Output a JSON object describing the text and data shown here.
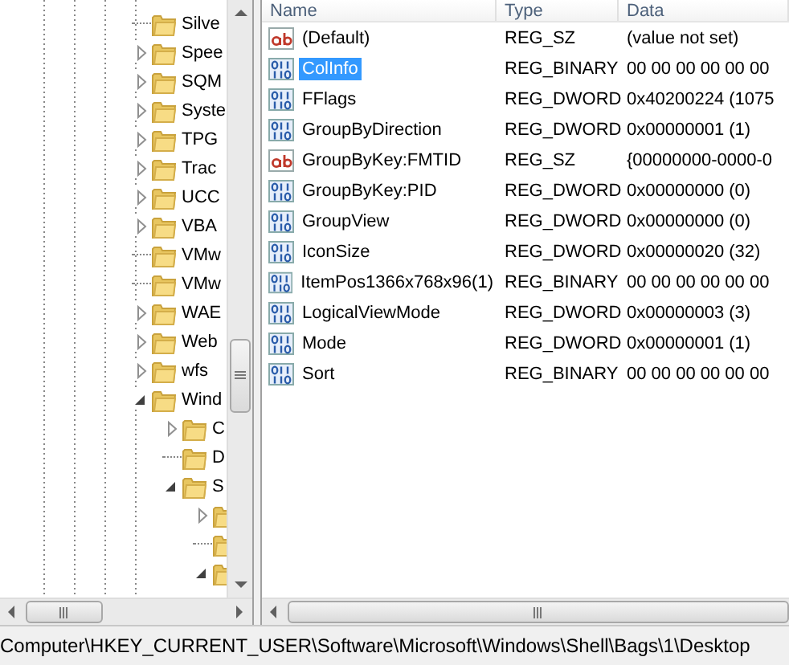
{
  "tree": {
    "items": [
      {
        "label": "Silve",
        "kind": "leaf"
      },
      {
        "label": "Spee",
        "kind": "branch",
        "expanded": false
      },
      {
        "label": "SQM",
        "kind": "branch",
        "expanded": false
      },
      {
        "label": "Syste",
        "kind": "branch",
        "expanded": false
      },
      {
        "label": "TPG",
        "kind": "branch",
        "expanded": false
      },
      {
        "label": "Trac",
        "kind": "branch",
        "expanded": false
      },
      {
        "label": "UCC",
        "kind": "branch",
        "expanded": false
      },
      {
        "label": "VBA",
        "kind": "branch",
        "expanded": false
      },
      {
        "label": "VMw",
        "kind": "leaf"
      },
      {
        "label": "VMw",
        "kind": "leaf"
      },
      {
        "label": "WAE",
        "kind": "branch",
        "expanded": false
      },
      {
        "label": "Web",
        "kind": "branch",
        "expanded": false
      },
      {
        "label": "wfs",
        "kind": "branch",
        "expanded": false
      },
      {
        "label": "Wind",
        "kind": "branch",
        "expanded": true,
        "children": [
          {
            "label": "C",
            "kind": "branch",
            "expanded": false
          },
          {
            "label": "D",
            "kind": "leaf"
          },
          {
            "label": "S",
            "kind": "branch",
            "expanded": true,
            "children": [
              {
                "kind": "branch",
                "expanded": false
              },
              {
                "kind": "leaf"
              },
              {
                "kind": "branch",
                "expanded": true
              }
            ]
          }
        ]
      }
    ]
  },
  "list": {
    "columns": [
      "Name",
      "Type",
      "Data"
    ],
    "rows": [
      {
        "kind": "string",
        "name": "(Default)",
        "type": "REG_SZ",
        "data": "(value not set)",
        "selected": false
      },
      {
        "kind": "binary",
        "name": "ColInfo",
        "type": "REG_BINARY",
        "data": "00 00 00 00 00 00",
        "selected": true
      },
      {
        "kind": "binary",
        "name": "FFlags",
        "type": "REG_DWORD",
        "data": "0x40200224 (1075",
        "selected": false
      },
      {
        "kind": "binary",
        "name": "GroupByDirection",
        "type": "REG_DWORD",
        "data": "0x00000001 (1)",
        "selected": false
      },
      {
        "kind": "string",
        "name": "GroupByKey:FMTID",
        "type": "REG_SZ",
        "data": "{00000000-0000-0",
        "selected": false
      },
      {
        "kind": "binary",
        "name": "GroupByKey:PID",
        "type": "REG_DWORD",
        "data": "0x00000000 (0)",
        "selected": false
      },
      {
        "kind": "binary",
        "name": "GroupView",
        "type": "REG_DWORD",
        "data": "0x00000000 (0)",
        "selected": false
      },
      {
        "kind": "binary",
        "name": "IconSize",
        "type": "REG_DWORD",
        "data": "0x00000020 (32)",
        "selected": false
      },
      {
        "kind": "binary",
        "name": "ItemPos1366x768x96(1)",
        "type": "REG_BINARY",
        "data": "00 00 00 00 00 00",
        "selected": false
      },
      {
        "kind": "binary",
        "name": "LogicalViewMode",
        "type": "REG_DWORD",
        "data": "0x00000003 (3)",
        "selected": false
      },
      {
        "kind": "binary",
        "name": "Mode",
        "type": "REG_DWORD",
        "data": "0x00000001 (1)",
        "selected": false
      },
      {
        "kind": "binary",
        "name": "Sort",
        "type": "REG_BINARY",
        "data": "00 00 00 00 00 00",
        "selected": false
      }
    ]
  },
  "status_bar": "Computer\\HKEY_CURRENT_USER\\Software\\Microsoft\\Windows\\Shell\\Bags\\1\\Desktop"
}
